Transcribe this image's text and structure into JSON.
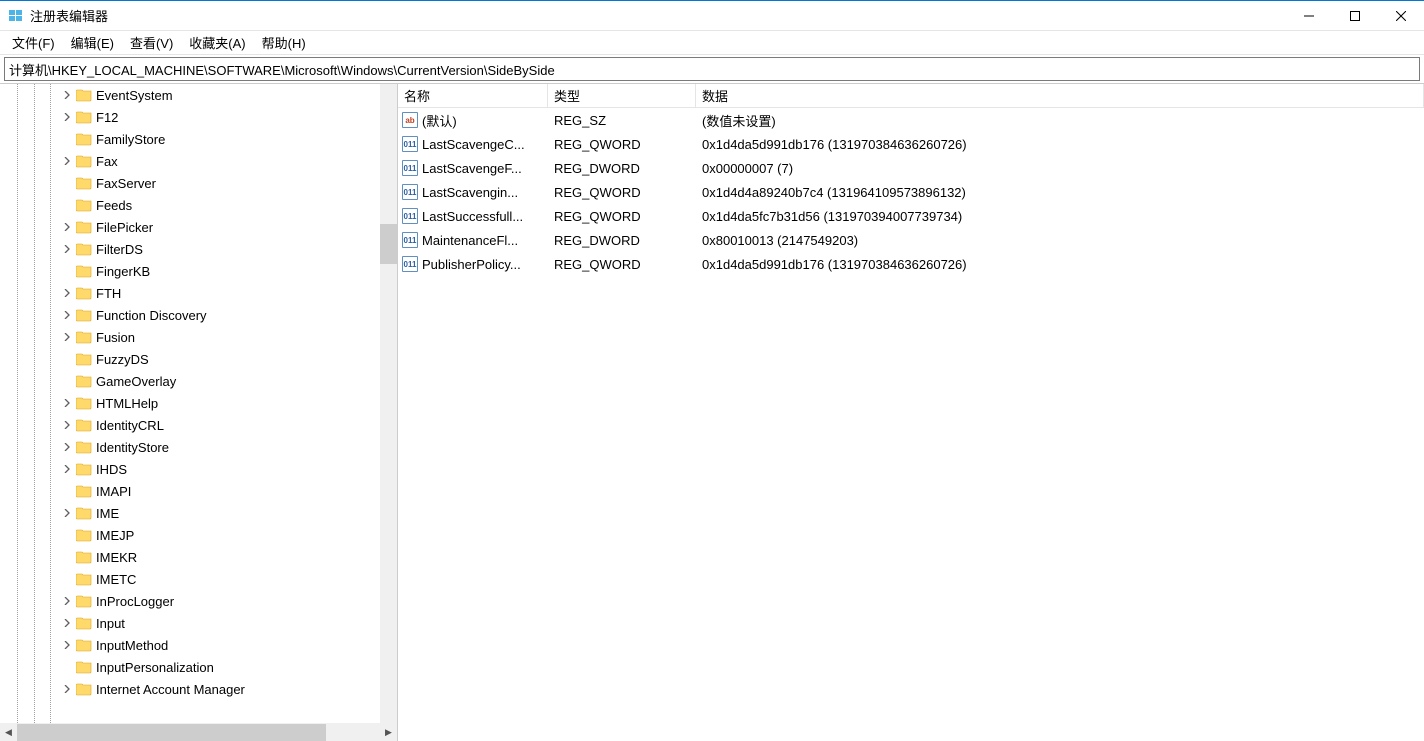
{
  "window": {
    "title": "注册表编辑器"
  },
  "menu": {
    "file": "文件(F)",
    "edit": "编辑(E)",
    "view": "查看(V)",
    "favorites": "收藏夹(A)",
    "help": "帮助(H)"
  },
  "address": "计算机\\HKEY_LOCAL_MACHINE\\SOFTWARE\\Microsoft\\Windows\\CurrentVersion\\SideBySide",
  "columns": {
    "name": "名称",
    "type": "类型",
    "data": "数据"
  },
  "tree": [
    {
      "label": "EventSystem",
      "expandable": true
    },
    {
      "label": "F12",
      "expandable": true
    },
    {
      "label": "FamilyStore",
      "expandable": false
    },
    {
      "label": "Fax",
      "expandable": true
    },
    {
      "label": "FaxServer",
      "expandable": false
    },
    {
      "label": "Feeds",
      "expandable": false
    },
    {
      "label": "FilePicker",
      "expandable": true
    },
    {
      "label": "FilterDS",
      "expandable": true
    },
    {
      "label": "FingerKB",
      "expandable": false
    },
    {
      "label": "FTH",
      "expandable": true
    },
    {
      "label": "Function Discovery",
      "expandable": true
    },
    {
      "label": "Fusion",
      "expandable": true
    },
    {
      "label": "FuzzyDS",
      "expandable": false
    },
    {
      "label": "GameOverlay",
      "expandable": false
    },
    {
      "label": "HTMLHelp",
      "expandable": true
    },
    {
      "label": "IdentityCRL",
      "expandable": true
    },
    {
      "label": "IdentityStore",
      "expandable": true
    },
    {
      "label": "IHDS",
      "expandable": true
    },
    {
      "label": "IMAPI",
      "expandable": false
    },
    {
      "label": "IME",
      "expandable": true
    },
    {
      "label": "IMEJP",
      "expandable": false
    },
    {
      "label": "IMEKR",
      "expandable": false
    },
    {
      "label": "IMETC",
      "expandable": false
    },
    {
      "label": "InProcLogger",
      "expandable": true
    },
    {
      "label": "Input",
      "expandable": true
    },
    {
      "label": "InputMethod",
      "expandable": true
    },
    {
      "label": "InputPersonalization",
      "expandable": false
    },
    {
      "label": "Internet Account Manager",
      "expandable": true
    }
  ],
  "values": [
    {
      "icon": "string",
      "iconText": "ab",
      "name": "(默认)",
      "type": "REG_SZ",
      "data": "(数值未设置)"
    },
    {
      "icon": "binary",
      "iconText": "011",
      "name": "LastScavengeC...",
      "type": "REG_QWORD",
      "data": "0x1d4da5d991db176 (131970384636260726)"
    },
    {
      "icon": "binary",
      "iconText": "011",
      "name": "LastScavengeF...",
      "type": "REG_DWORD",
      "data": "0x00000007 (7)"
    },
    {
      "icon": "binary",
      "iconText": "011",
      "name": "LastScavengin...",
      "type": "REG_QWORD",
      "data": "0x1d4d4a89240b7c4 (131964109573896132)"
    },
    {
      "icon": "binary",
      "iconText": "011",
      "name": "LastSuccessfull...",
      "type": "REG_QWORD",
      "data": "0x1d4da5fc7b31d56 (131970394007739734)"
    },
    {
      "icon": "binary",
      "iconText": "011",
      "name": "MaintenanceFl...",
      "type": "REG_DWORD",
      "data": "0x80010013 (2147549203)"
    },
    {
      "icon": "binary",
      "iconText": "011",
      "name": "PublisherPolicy...",
      "type": "REG_QWORD",
      "data": "0x1d4da5d991db176 (131970384636260726)"
    }
  ]
}
